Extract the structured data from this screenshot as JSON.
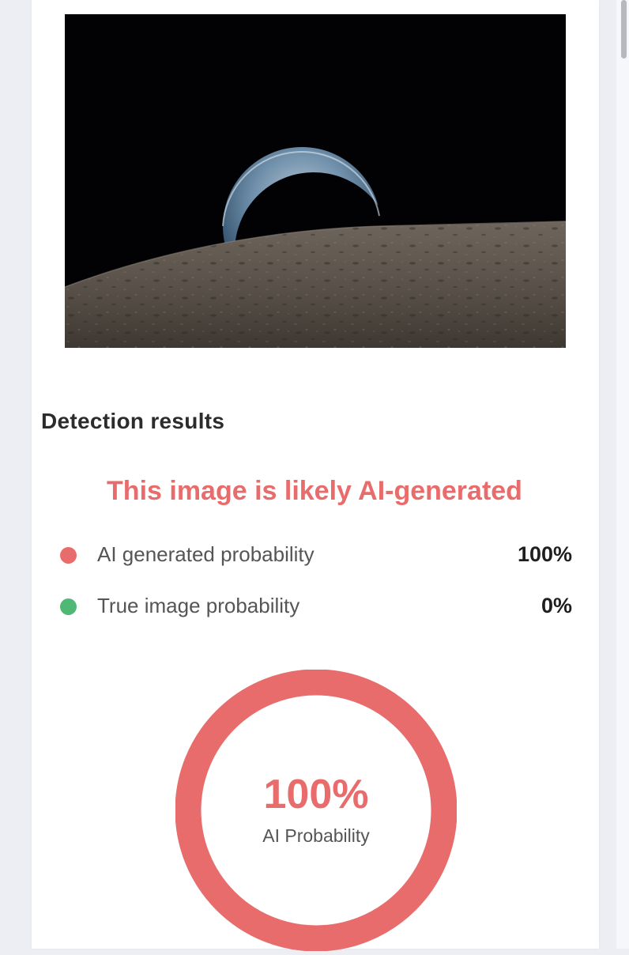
{
  "detection": {
    "title": "Detection results",
    "verdict": "This image is likely AI-generated",
    "rows": [
      {
        "label": "AI generated probability",
        "value": "100%",
        "dot_color": "#e86c6b"
      },
      {
        "label": "True image probability",
        "value": "0%",
        "dot_color": "#4fb874"
      }
    ]
  },
  "donut": {
    "value": "100%",
    "label": "AI Probability",
    "ai_probability": 1.0,
    "color": "#e86c6b"
  },
  "colors": {
    "accent_red": "#e86c6b",
    "accent_green": "#4fb874"
  }
}
